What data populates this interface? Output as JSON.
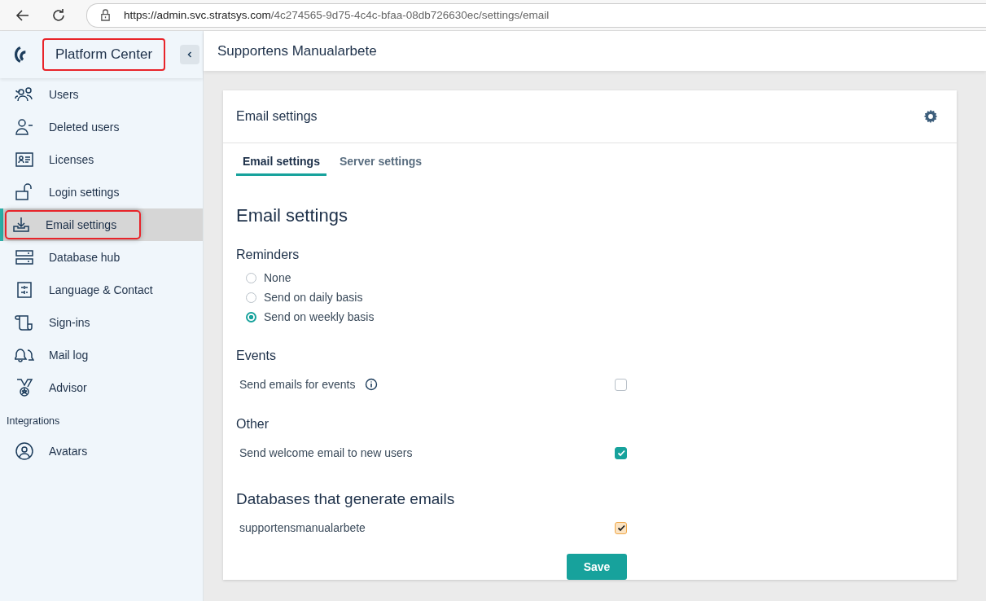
{
  "browser": {
    "url_host": "https://admin.svc.stratsys.com",
    "url_path": "/4c274565-9d75-4c4c-bfaa-08db726630ec/settings/email"
  },
  "sidebar": {
    "title": "Platform Center",
    "title_highlighted": true,
    "items": [
      {
        "label": "Users",
        "selected": false,
        "highlighted": false
      },
      {
        "label": "Deleted users",
        "selected": false,
        "highlighted": false
      },
      {
        "label": "Licenses",
        "selected": false,
        "highlighted": false
      },
      {
        "label": "Login settings",
        "selected": false,
        "highlighted": false
      },
      {
        "label": "Email settings",
        "selected": true,
        "highlighted": true
      },
      {
        "label": "Database hub",
        "selected": false,
        "highlighted": false
      },
      {
        "label": "Language & Contact",
        "selected": false,
        "highlighted": false
      },
      {
        "label": "Sign-ins",
        "selected": false,
        "highlighted": false
      },
      {
        "label": "Mail log",
        "selected": false,
        "highlighted": false
      },
      {
        "label": "Advisor",
        "selected": false,
        "highlighted": false
      }
    ],
    "section": "Integrations",
    "section_items": [
      {
        "label": "Avatars",
        "selected": false,
        "highlighted": false
      }
    ]
  },
  "header": {
    "title": "Supportens Manualarbete"
  },
  "card": {
    "title": "Email settings",
    "tabs": [
      {
        "label": "Email settings",
        "selected": true
      },
      {
        "label": "Server settings",
        "selected": false
      }
    ],
    "heading": "Email settings",
    "reminders": {
      "title": "Reminders",
      "options": [
        {
          "label": "None",
          "selected": false
        },
        {
          "label": "Send on daily basis",
          "selected": false
        },
        {
          "label": "Send on weekly basis",
          "selected": true
        }
      ]
    },
    "groups": [
      {
        "title": "Events",
        "large": false,
        "rows": [
          {
            "label": "Send emails for events",
            "info": true,
            "checked": false,
            "focused": false
          }
        ]
      },
      {
        "title": "Other",
        "large": false,
        "rows": [
          {
            "label": "Send welcome email to new users",
            "info": false,
            "checked": true,
            "focused": false
          }
        ]
      },
      {
        "title": "Databases that generate emails",
        "large": true,
        "rows": [
          {
            "label": "supportensmanualarbete",
            "info": false,
            "checked": true,
            "focused": true
          }
        ]
      }
    ],
    "save": "Save"
  }
}
